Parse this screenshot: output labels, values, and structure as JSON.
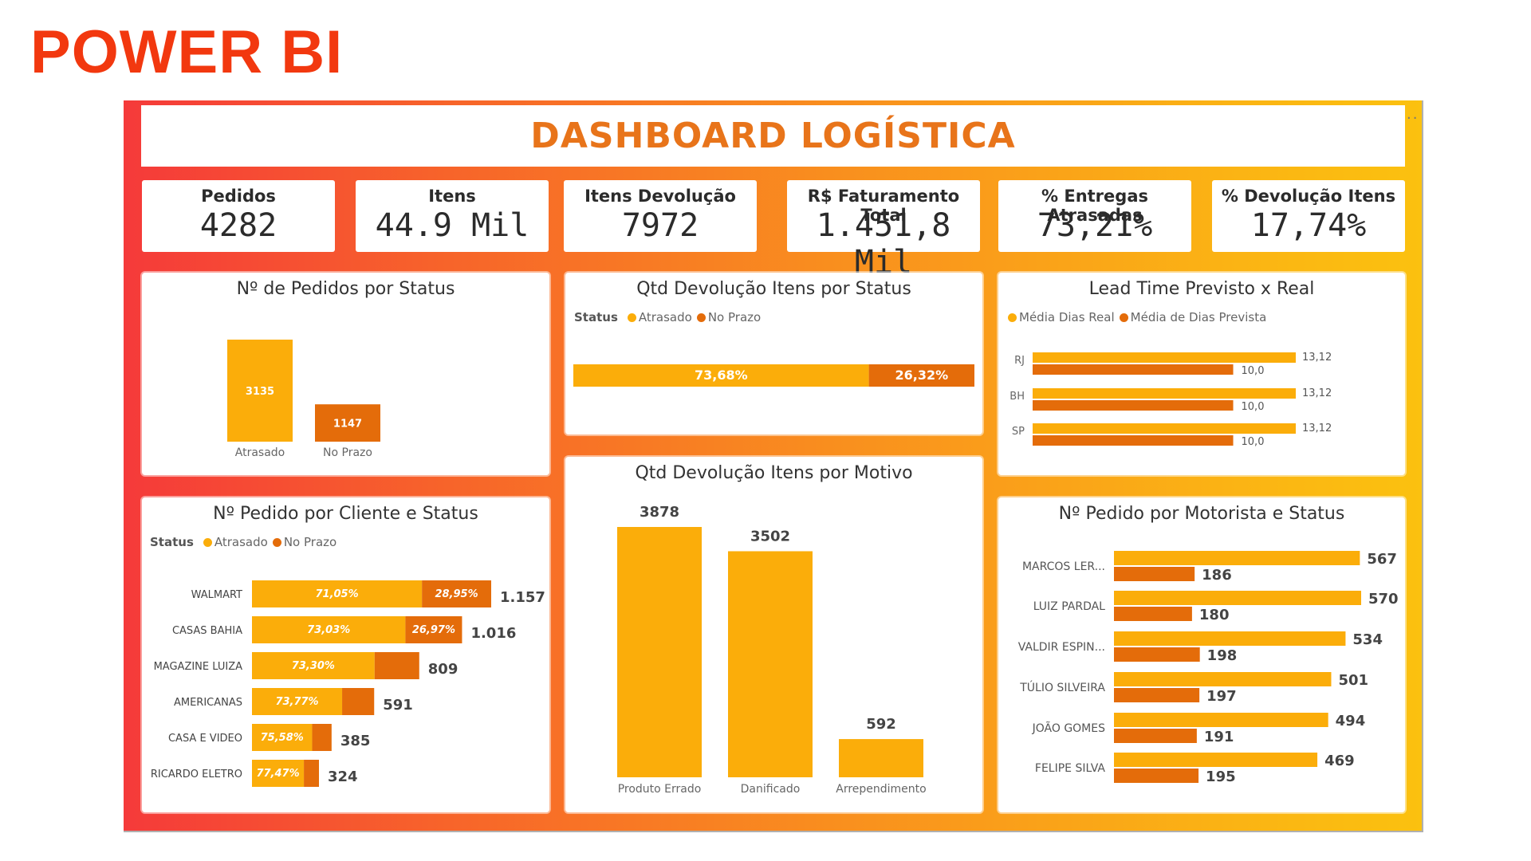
{
  "brand": "POWER BI",
  "menu_dots": "..",
  "dashboard_title": "DASHBOARD LOGÍSTICA",
  "colors": {
    "atrasado": "#fbad0a",
    "no_prazo": "#e46c0a",
    "accent_title": "#e8741a",
    "brand": "#f2380f"
  },
  "kpis": [
    {
      "label": "Pedidos",
      "value": "4282"
    },
    {
      "label": "Itens",
      "value": "44.9 Mil"
    },
    {
      "label": "Itens Devolução",
      "value": "7972"
    },
    {
      "label": "R$ Faturamento Total",
      "value": "1.451,8 Mil"
    },
    {
      "label": "% Entregas Atrasadas",
      "value": "73,21%"
    },
    {
      "label": "% Devolução Itens",
      "value": "17,74%"
    }
  ],
  "chart_data": [
    {
      "id": "pedidos_status",
      "type": "bar",
      "title": "Nº de Pedidos por Status",
      "categories": [
        "Atrasado",
        "No Prazo"
      ],
      "values": [
        3135,
        1147
      ],
      "value_labels": [
        "3135",
        "1147"
      ]
    },
    {
      "id": "devolucao_status",
      "type": "bar",
      "stacked": true,
      "orientation": "horizontal",
      "title": "Qtd Devolução Itens por Status",
      "legend_title": "Status",
      "series": [
        {
          "name": "Atrasado",
          "values": [
            73.68
          ],
          "label": "73,68%"
        },
        {
          "name": "No Prazo",
          "values": [
            26.32
          ],
          "label": "26,32%"
        }
      ]
    },
    {
      "id": "lead_time",
      "type": "bar",
      "orientation": "horizontal",
      "title": "Lead Time Previsto x Real",
      "categories": [
        "RJ",
        "BH",
        "SP"
      ],
      "series": [
        {
          "name": "Média Dias Real",
          "values": [
            13.12,
            13.12,
            13.12
          ],
          "labels": [
            "13,12",
            "13,12",
            "13,12"
          ]
        },
        {
          "name": "Média de Dias Prevista",
          "values": [
            10.0,
            10.0,
            10.0
          ],
          "labels": [
            "10,0",
            "10,0",
            "10,0"
          ]
        }
      ]
    },
    {
      "id": "devolucao_motivo",
      "type": "bar",
      "title": "Qtd Devolução Itens por Motivo",
      "categories": [
        "Produto Errado",
        "Danificado",
        "Arrependimento"
      ],
      "values": [
        3878,
        3502,
        592
      ],
      "value_labels": [
        "3878",
        "3502",
        "592"
      ]
    },
    {
      "id": "pedido_cliente",
      "type": "bar",
      "stacked": true,
      "orientation": "horizontal",
      "title": "Nº Pedido por Cliente e Status",
      "legend_title": "Status",
      "legend": [
        "Atrasado",
        "No Prazo"
      ],
      "rows": [
        {
          "name": "WALMART",
          "total": 1157,
          "total_label": "1.157",
          "pct_atrasado": 71.05,
          "label_atrasado": "71,05%",
          "label_prazo": "28,95%"
        },
        {
          "name": "CASAS BAHIA",
          "total": 1016,
          "total_label": "1.016",
          "pct_atrasado": 73.03,
          "label_atrasado": "73,03%",
          "label_prazo": "26,97%"
        },
        {
          "name": "MAGAZINE LUIZA",
          "total": 809,
          "total_label": "809",
          "pct_atrasado": 73.3,
          "label_atrasado": "73,30%",
          "label_prazo": ""
        },
        {
          "name": "AMERICANAS",
          "total": 591,
          "total_label": "591",
          "pct_atrasado": 73.77,
          "label_atrasado": "73,77%",
          "label_prazo": ""
        },
        {
          "name": "CASA E VIDEO",
          "total": 385,
          "total_label": "385",
          "pct_atrasado": 75.58,
          "label_atrasado": "75,58%",
          "label_prazo": ""
        },
        {
          "name": "RICARDO ELETRO",
          "total": 324,
          "total_label": "324",
          "pct_atrasado": 77.47,
          "label_atrasado": "77,47%",
          "label_prazo": ""
        }
      ]
    },
    {
      "id": "pedido_motorista",
      "type": "bar",
      "orientation": "horizontal",
      "title": "Nº Pedido por Motorista e Status",
      "rows": [
        {
          "name": "MARCOS LER...",
          "atrasado": 567,
          "no_prazo": 186
        },
        {
          "name": "LUIZ PARDAL",
          "atrasado": 570,
          "no_prazo": 180
        },
        {
          "name": "VALDIR ESPIN...",
          "atrasado": 534,
          "no_prazo": 198
        },
        {
          "name": "TÚLIO SILVEIRA",
          "atrasado": 501,
          "no_prazo": 197
        },
        {
          "name": "JOÃO GOMES",
          "atrasado": 494,
          "no_prazo": 191
        },
        {
          "name": "FELIPE SILVA",
          "atrasado": 469,
          "no_prazo": 195
        }
      ]
    }
  ]
}
